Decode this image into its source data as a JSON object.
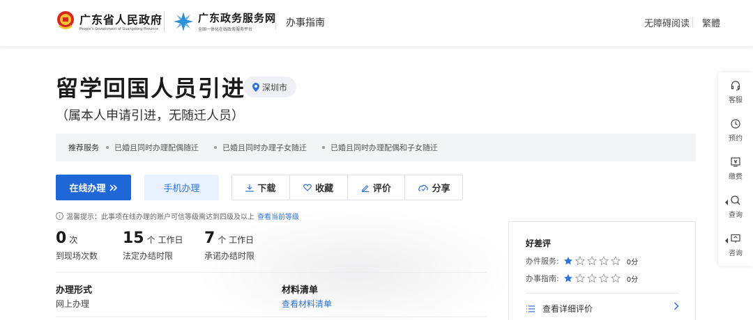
{
  "header": {
    "gov_name": "广东省人民政府",
    "gov_sub": "People's Government of Guangdong Province",
    "svc_name": "广东政务服务网",
    "svc_sub": "全国一体化在线政务服务平台",
    "guide": "办事指南",
    "barrier_free": "无障碍阅读",
    "traditional": "繁體"
  },
  "service": {
    "title": "留学回国人员引进",
    "location": "深圳市",
    "subtitle": "（属本人申请引进，无随迁人员）"
  },
  "recommend": {
    "label": "推荐服务",
    "items": [
      "已婚且同时办理配偶随迁",
      "已婚且同时办理子女随迁",
      "已婚且同时办理配偶和子女随迁"
    ]
  },
  "actions": {
    "online": "在线办理",
    "mobile": "手机办理",
    "download": "下载",
    "favorite": "收藏",
    "evaluate": "评价",
    "share": "分享"
  },
  "tip": {
    "text": "温馨提示：此事项在线办理的账户可信等级需达到四级及以上",
    "link": "查看当前等级"
  },
  "stats": [
    {
      "num": "0",
      "unit": "次",
      "label": "到现场次数"
    },
    {
      "num": "15",
      "unit": "个 工作日",
      "label": "法定办结时限"
    },
    {
      "num": "7",
      "unit": "个 工作日",
      "label": "承诺办结时限"
    }
  ],
  "info": {
    "mode_label": "办理形式",
    "mode_value": "网上办理",
    "materials_label": "材料清单",
    "materials_link": "查看材料清单"
  },
  "rating": {
    "title": "好差评",
    "service_label": "办件服务:",
    "service_score": "0分",
    "guide_label": "办事指南:",
    "guide_score": "0分",
    "detail": "查看详细评价"
  },
  "float": {
    "kefu": "客服",
    "yuyue": "预约",
    "jiaofei": "缴费",
    "chaxun": "查询",
    "zixun": "咨询"
  },
  "colors": {
    "primary": "#1f67d6",
    "link": "#2d74db",
    "star": "#2d74db"
  }
}
